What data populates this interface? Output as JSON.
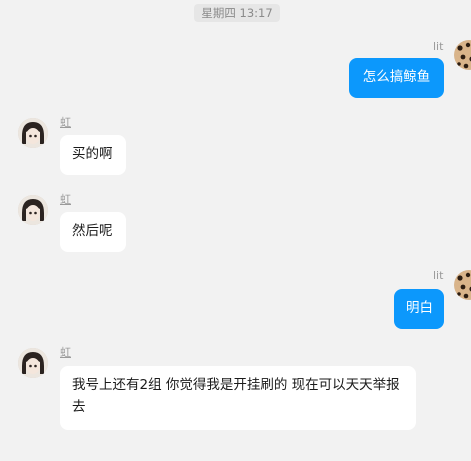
{
  "conversation": {
    "timestamp": "星期四 13:17",
    "messages": [
      {
        "sender": "lit",
        "direction": "out",
        "text": "怎么搞鲸鱼"
      },
      {
        "sender": "虹",
        "direction": "in",
        "text": "买的啊"
      },
      {
        "sender": "虹",
        "direction": "in",
        "text": "然后呢"
      },
      {
        "sender": "lit",
        "direction": "out",
        "text": "明白"
      },
      {
        "sender": "虹",
        "direction": "in",
        "text": "我号上还有2组 你觉得我是开挂刷的 现在可以天天举报去"
      }
    ]
  },
  "colors": {
    "background": "#f2f2f2",
    "incoming_bubble": "#ffffff",
    "outgoing_bubble": "#0c98fc"
  },
  "icons": {
    "incoming_avatar": "anime-girl-avatar-icon",
    "outgoing_avatar": "leopard-pattern-avatar-icon"
  }
}
